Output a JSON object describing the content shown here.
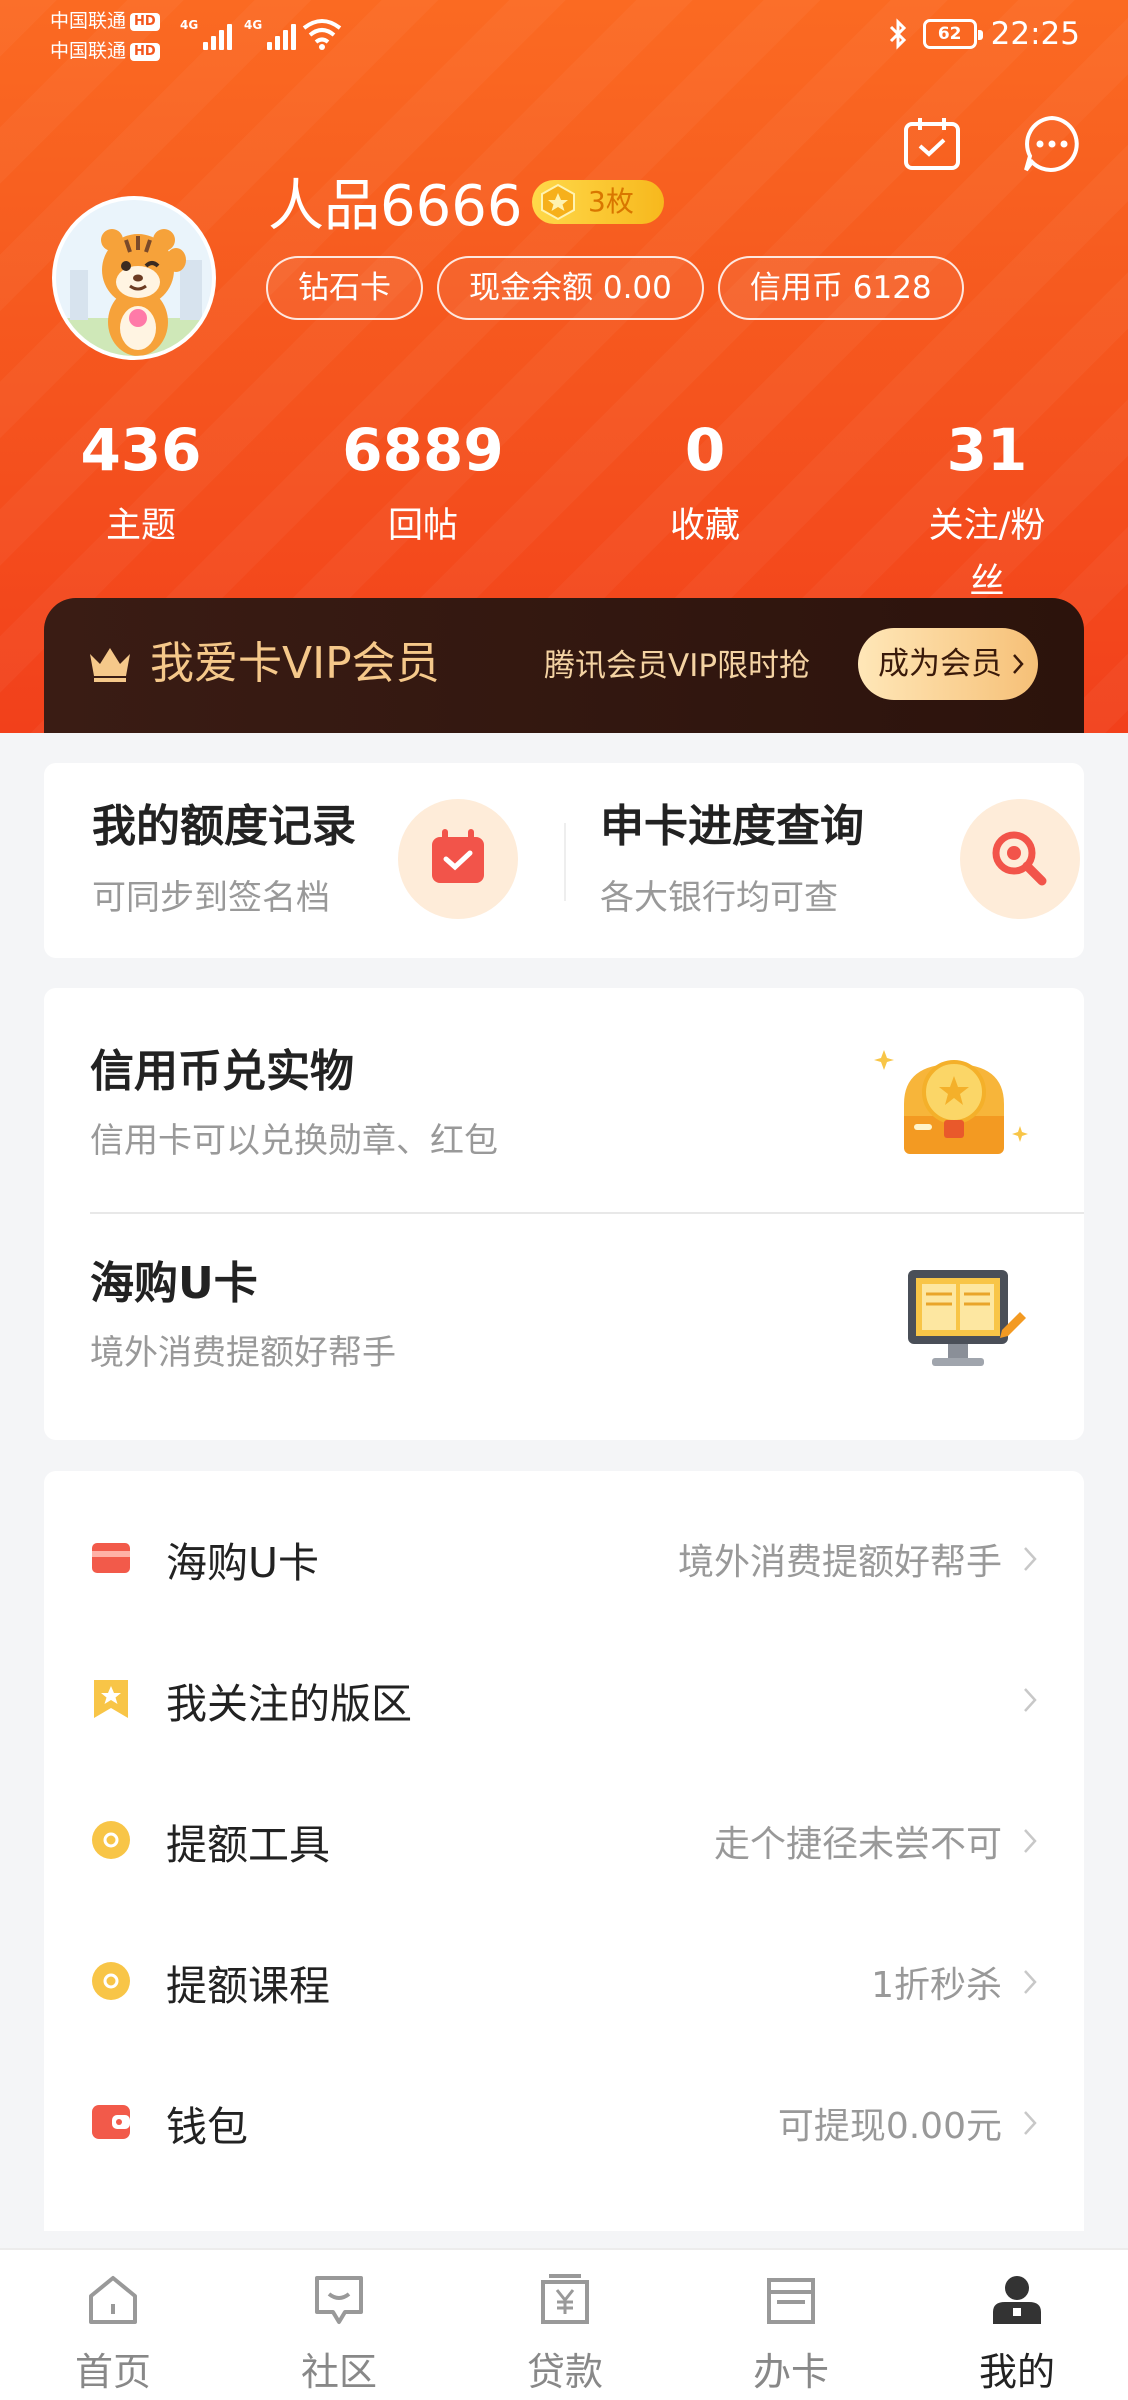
{
  "status_bar": {
    "carrier_1": "中国联通",
    "carrier_2": "中国联通",
    "hd_badge": "HD",
    "network_1": "4G",
    "network_2": "4G",
    "battery": "62",
    "time": "22:25",
    "icons": [
      "bluetooth-icon",
      "battery-icon",
      "wifi-icon",
      "signal-icon"
    ]
  },
  "header_actions": [
    "calendar-checkin-icon",
    "message-icon"
  ],
  "profile": {
    "username": "人品6666",
    "coin_count": "3枚",
    "tags": [
      "钻石卡",
      "现金余额 0.00",
      "信用币 6128"
    ]
  },
  "stats": [
    {
      "value": "436",
      "label": "主题"
    },
    {
      "value": "6889",
      "label": "回帖"
    },
    {
      "value": "0",
      "label": "收藏"
    },
    {
      "value": "31",
      "label": "关注/粉丝"
    }
  ],
  "vip": {
    "title": "我爱卡VIP会员",
    "promo": "腾讯会员VIP限时抢",
    "button": "成为会员"
  },
  "quick_cards": [
    {
      "title": "我的额度记录",
      "subtitle": "可同步到签名档",
      "icon": "calendar-check-icon"
    },
    {
      "title": "申卡进度查询",
      "subtitle": "各大银行均可查",
      "icon": "magnifier-icon"
    }
  ],
  "features": [
    {
      "title": "信用币兑实物",
      "subtitle": "信用卡可以兑换勋章、红包",
      "icon": "treasure-chest-icon"
    },
    {
      "title": "海购U卡",
      "subtitle": "境外消费提额好帮手",
      "icon": "computer-monitor-icon"
    }
  ],
  "menu": [
    {
      "label": "海购U卡",
      "value": "境外消费提额好帮手",
      "icon": "card-icon"
    },
    {
      "label": "我关注的版区",
      "value": "",
      "icon": "star-bookmark-icon"
    },
    {
      "label": "提额工具",
      "value": "走个捷径未尝不可",
      "icon": "coin-icon"
    },
    {
      "label": "提额课程",
      "value": "1折秒杀",
      "icon": "coin-icon"
    },
    {
      "label": "钱包",
      "value": "可提现0.00元",
      "icon": "wallet-icon"
    }
  ],
  "tabs": [
    {
      "label": "首页",
      "icon": "home-icon",
      "active": false
    },
    {
      "label": "社区",
      "icon": "chat-icon",
      "active": false
    },
    {
      "label": "贷款",
      "icon": "yuan-icon",
      "active": false
    },
    {
      "label": "办卡",
      "icon": "card-icon",
      "active": false
    },
    {
      "label": "我的",
      "icon": "person-icon",
      "active": true
    }
  ],
  "colors": {
    "header_top": "#fb6a22",
    "header_bottom": "#f2401b",
    "vip_bg": "#2c130c",
    "vip_text": "#f5c88a",
    "accent_orange": "#f4561d",
    "icon_yellow": "#f8c547",
    "icon_red": "#f25a4a"
  }
}
